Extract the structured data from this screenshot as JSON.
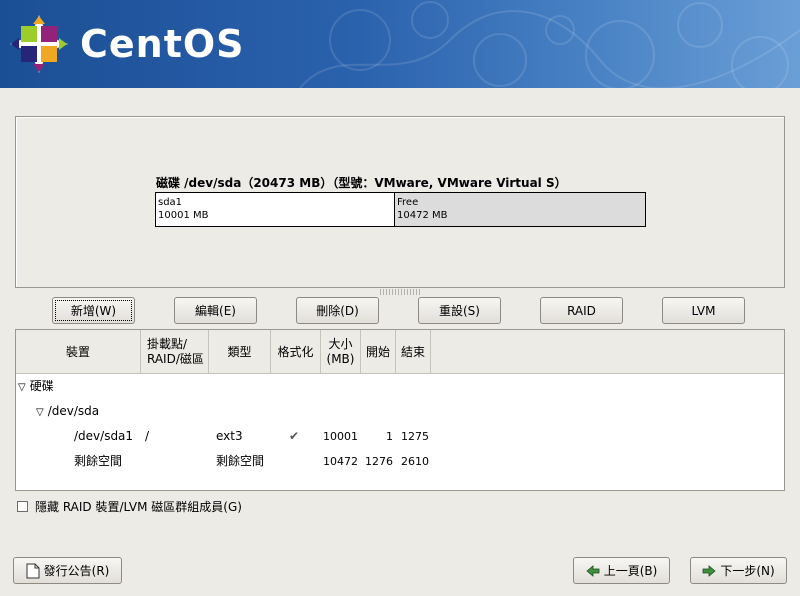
{
  "banner": {
    "brand": "CentOS"
  },
  "disk": {
    "title": "磁碟 /dev/sda（20473 MB）（型號：VMware, VMware Virtual S）",
    "segments": [
      {
        "name": "sda1",
        "size": "10001 MB"
      },
      {
        "name": "Free",
        "size": "10472 MB"
      }
    ]
  },
  "toolbar": {
    "new": "新增(W)",
    "edit": "編輯(E)",
    "delete": "刪除(D)",
    "reset": "重設(S)",
    "raid": "RAID",
    "lvm": "LVM"
  },
  "table": {
    "headers": {
      "device": "裝置",
      "mount": "掛載點/\nRAID/磁區",
      "type": "類型",
      "format": "格式化",
      "size": "大小\n(MB)",
      "start": "開始",
      "end": "結束"
    },
    "rows": {
      "hard_disks": "硬碟",
      "sda": "/dev/sda",
      "sda1": {
        "device": "/dev/sda1",
        "mount": "/",
        "type": "ext3",
        "format": "✔",
        "size": "10001",
        "start": "1",
        "end": "1275"
      },
      "free": {
        "device": "剩餘空間",
        "mount": "",
        "type": "剩餘空間",
        "format": "",
        "size": "10472",
        "start": "1276",
        "end": "2610"
      }
    }
  },
  "hide_members": {
    "label": "隱藏 RAID 裝置/LVM 磁區群組成員(G)",
    "checked": false
  },
  "footer": {
    "release_notes": "發行公告(R)",
    "back": "上一頁(B)",
    "next": "下一步(N)"
  },
  "icons": {
    "brand_logo": "centos-logo-icon",
    "expand": "triangle-down-icon",
    "release_notes": "document-icon",
    "back": "arrow-left-icon",
    "next": "arrow-right-icon"
  }
}
